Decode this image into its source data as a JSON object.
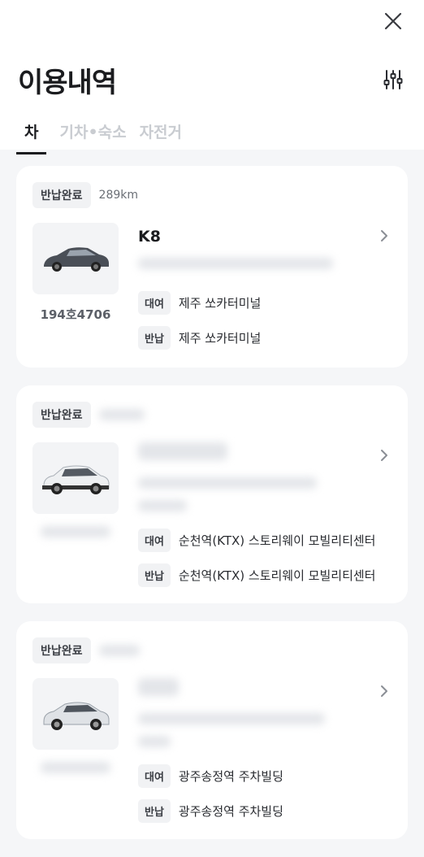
{
  "header": {
    "title": "이용내역",
    "tabs": [
      {
        "label": "차",
        "active": true
      },
      {
        "label": "기차•숙소",
        "active": false
      },
      {
        "label": "자전거",
        "active": false
      }
    ]
  },
  "cards": [
    {
      "status": "반납완료",
      "distance": "289km",
      "car_name": "K8",
      "plate": "194호4706",
      "rent_label": "대여",
      "rent_location": "제주 쏘카터미널",
      "return_label": "반납",
      "return_location": "제주 쏘카터미널"
    },
    {
      "status": "반납완료",
      "rent_label": "대여",
      "rent_location": "순천역(KTX) 스토리웨이 모빌리티센터",
      "return_label": "반납",
      "return_location": "순천역(KTX) 스토리웨이 모빌리티센터"
    },
    {
      "status": "반납완료",
      "rent_label": "대여",
      "rent_location": "광주송정역 주차빌딩",
      "return_label": "반납",
      "return_location": "광주송정역 주차빌딩"
    }
  ],
  "icons": {
    "close": "close-icon",
    "filter": "filter-sliders-icon",
    "chevron": "chevron-right-icon"
  }
}
